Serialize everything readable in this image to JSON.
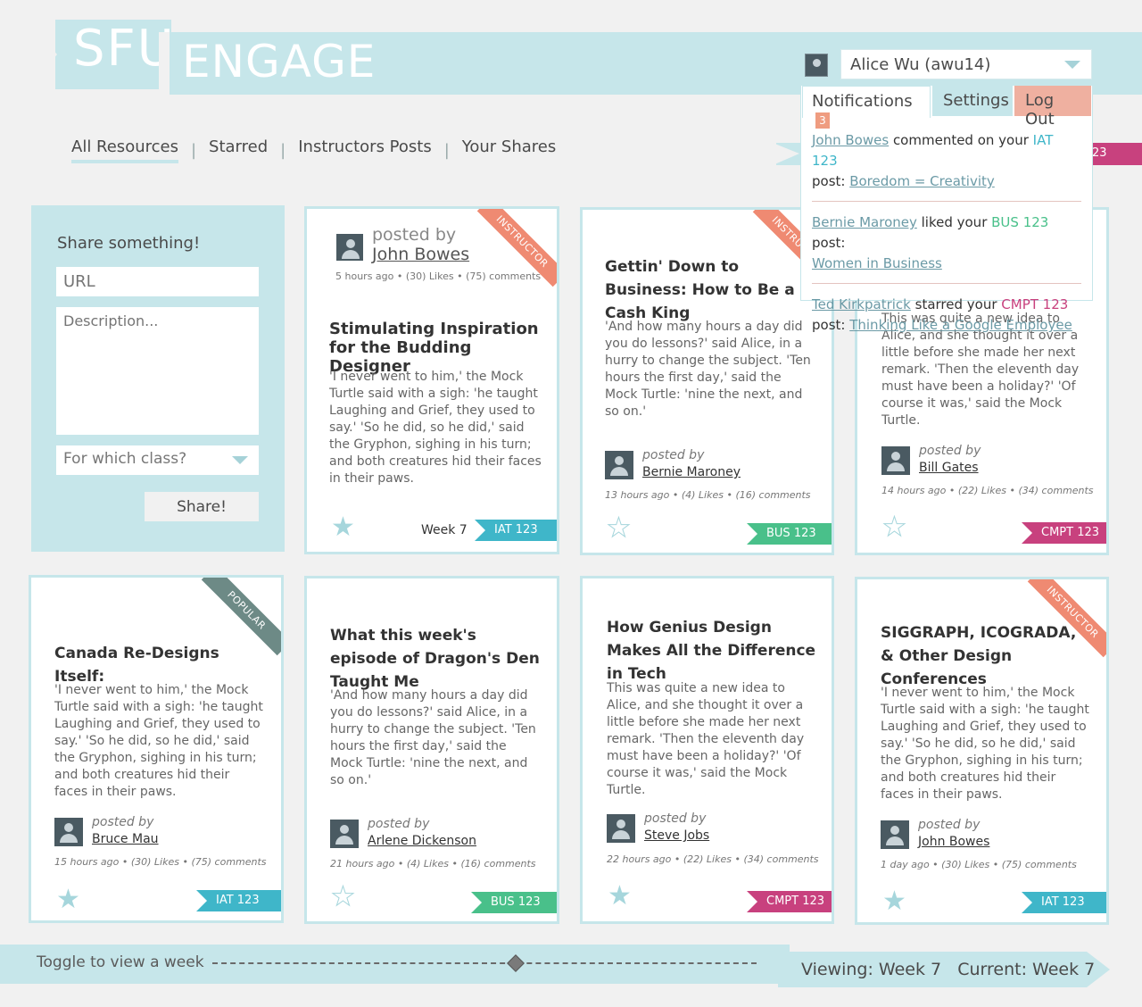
{
  "brand": {
    "sfu": "SFU",
    "engage": "ENGAGE"
  },
  "user": {
    "name": "Alice Wu (awu14)"
  },
  "menu": {
    "notifications_label": "Notifications",
    "notifications_count": "3",
    "settings_label": "Settings",
    "logout_label": "Log Out"
  },
  "notifications": [
    {
      "actor": "John Bowes",
      "verb": " commented on your ",
      "course": "IAT 123",
      "course_color": "#3fb6c9",
      "mid": " post: ",
      "post": "Boredom = Creativity"
    },
    {
      "actor": "Bernie Maroney",
      "verb": " liked your ",
      "course": "BUS 123",
      "course_color": "#49c08a",
      "mid": " post: ",
      "post": "Women in Business"
    },
    {
      "actor": "Ted Kirkpatrick",
      "verb": " starred your ",
      "course": "CMPT 123",
      "course_color": "#c8417e",
      "mid": " post: ",
      "post": "Thinking Like a Google Employee"
    }
  ],
  "nav": {
    "items": [
      "All Resources",
      "Starred",
      "Instructors Posts",
      "Your Shares"
    ],
    "ribbon_peek": "23"
  },
  "share": {
    "title": "Share something!",
    "url_placeholder": "URL",
    "desc_placeholder": "Description...",
    "class_placeholder": "For which class?",
    "button": "Share!"
  },
  "cards": [
    {
      "title": "Stimulating Inspiration for the Budding Designer",
      "body": "'I never went to him,' the Mock Turtle said with a sigh: 'he taught Laughing and Grief, they used to say.' 'So he did, so he did,' said the Gryphon, sighing in his turn; and both creatures hid their faces in their paws.",
      "posted_label": "posted by",
      "author": "John Bowes",
      "meta": "5 hours ago • (30) Likes • (75) comments",
      "tag": "IAT 123",
      "week": "Week 7",
      "corner": "INSTRUCTOR"
    },
    {
      "title": "Gettin' Down to Business: How to Be a Cash King",
      "body": "'And how many hours a day did you do lessons?' said Alice, in a hurry to change the subject. 'Ten hours the first day,' said the Mock Turtle: 'nine the next, and so on.'",
      "posted_label": "posted by",
      "author": "Bernie Maroney",
      "meta": "13 hours ago • (4) Likes • (16) comments",
      "tag": "BUS 123",
      "corner": "INSTRUCTOR"
    },
    {
      "body": "This was quite a new idea to Alice, and she thought it over a little before she made her next remark. 'Then the eleventh day must have been a holiday?' 'Of course it was,' said the Mock Turtle.",
      "posted_label": "posted by",
      "author": "Bill Gates",
      "meta": "14 hours ago • (22) Likes • (34) comments",
      "tag": "CMPT 123"
    },
    {
      "title": "Canada Re-Designs Itself:",
      "body": "'I never went to him,' the Mock Turtle said with a sigh: 'he taught Laughing and Grief, they used to say.' 'So he did, so he did,' said the Gryphon, sighing in his turn; and both creatures hid their faces in their paws.",
      "posted_label": "posted by",
      "author": "Bruce Mau",
      "meta": "15 hours ago • (30) Likes • (75) comments",
      "tag": "IAT 123",
      "corner": "POPULAR"
    },
    {
      "title": "What this week's episode of Dragon's Den Taught Me",
      "body": "'And how many hours a day did you do lessons?' said Alice, in a hurry to change the subject. 'Ten hours the first day,' said the Mock Turtle: 'nine the next, and so on.'",
      "posted_label": "posted by",
      "author": "Arlene Dickenson",
      "meta": "21 hours ago • (4) Likes • (16) comments",
      "tag": "BUS 123"
    },
    {
      "title": "How Genius Design Makes All the Difference in Tech",
      "body": "This was quite a new idea to Alice, and she thought it over a little before she made her next remark. 'Then the eleventh day must have been a holiday?' 'Of course it was,' said the Mock Turtle.",
      "posted_label": "posted by",
      "author": "Steve Jobs",
      "meta": "22 hours ago • (22) Likes • (34) comments",
      "tag": "CMPT 123"
    },
    {
      "title": "SIGGRAPH, ICOGRADA, & Other Design Conferences",
      "body": "'I never went to him,' the Mock Turtle said with a sigh: 'he taught Laughing and Grief, they used to say.' 'So he did, so he did,' said the Gryphon, sighing in his turn; and both creatures hid their faces in their paws.",
      "posted_label": "posted by",
      "author": "John Bowes",
      "meta": "1 day ago • (30) Likes • (75) comments",
      "tag": "IAT 123",
      "corner": "INSTRUCTOR"
    }
  ],
  "footer": {
    "toggle_label": "Toggle to view a week",
    "viewing": "Viewing: Week 7",
    "current": "Current: Week 7"
  },
  "colors": {
    "accent": "#c6e6ea",
    "iat": "#3fb6c9",
    "bus": "#49c08a",
    "cmpt": "#c8417e",
    "instructor": "#ef8a72",
    "popular": "#6d8a86"
  }
}
